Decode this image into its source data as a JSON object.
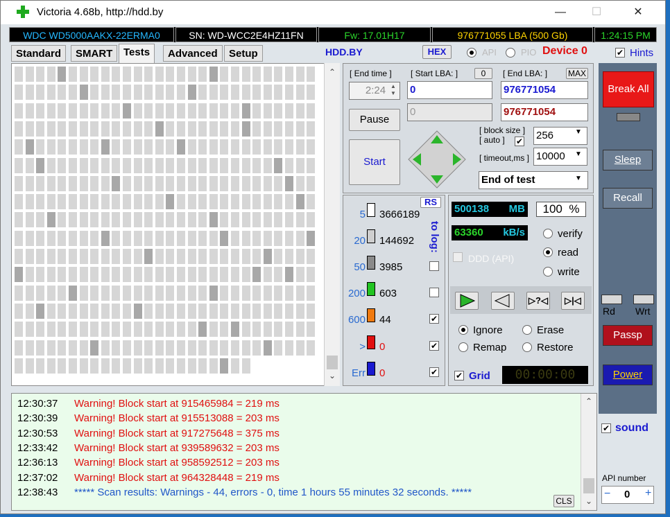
{
  "window": {
    "title": "Victoria 4.68b, http://hdd.by",
    "minimize": "—",
    "maximize": "☐",
    "close": "✕"
  },
  "info": {
    "model": "WDC WD5000AAKX-22ERMA0",
    "serial": "SN: WD-WCC2E4HZ11FN",
    "firmware": "Fw: 17.01H17",
    "lba": "976771055 LBA (500 Gb)",
    "clock": "1:24:15 PM"
  },
  "tabs": [
    "Standard",
    "SMART",
    "Tests",
    "Advanced",
    "Setup"
  ],
  "header": {
    "site": "HDD.BY",
    "hex": "HEX",
    "api": "API",
    "pio": "PIO",
    "device": "Device 0",
    "hints": "Hints"
  },
  "tests": {
    "end_time_label": "[ End time ]",
    "end_time_value": "2:24",
    "start_lba_label": "[ Start LBA: ]",
    "start_lba_zero": "0",
    "start_lba_value": "0",
    "start_lba_cur": "0",
    "end_lba_label": "[ End LBA: ]",
    "end_lba_max": "MAX",
    "end_lba_value": "976771054",
    "end_lba_cur": "976771054",
    "pause": "Pause",
    "start": "Start",
    "block_size_label1": "[ block size ]",
    "block_size_label2": "[ auto ]",
    "block_size_value": "256",
    "timeout_label": "[ timeout,ms ]",
    "timeout_value": "10000",
    "end_action": "End of test"
  },
  "counters": {
    "rs": "RS",
    "to_log": "to log:",
    "rows": [
      {
        "label": "5",
        "count": "3666189",
        "color": "#ffffff"
      },
      {
        "label": "20",
        "count": "144692",
        "color": "#cfcfcf"
      },
      {
        "label": "50",
        "count": "3985",
        "color": "#8a8a8a"
      },
      {
        "label": "200",
        "count": "603",
        "color": "#22c422"
      },
      {
        "label": "600",
        "count": "44",
        "color": "#f07a10"
      },
      {
        "label": ">",
        "count": "0",
        "color": "#e01010"
      },
      {
        "label": "Err",
        "count": "0",
        "color": "#1a1ad0"
      }
    ]
  },
  "stats": {
    "mb": "500138",
    "mb_unit": "MB",
    "percent": "100",
    "percent_unit": "%",
    "speed": "63360",
    "speed_unit": "kB/s",
    "ddd": "DDD (API)",
    "verify": "verify",
    "read": "read",
    "write": "write",
    "timer": "00:00:00"
  },
  "options": {
    "ignore": "Ignore",
    "erase": "Erase",
    "remap": "Remap",
    "restore": "Restore",
    "grid": "Grid"
  },
  "right": {
    "break_all": "Break All",
    "sleep": "Sleep",
    "recall": "Recall",
    "rd": "Rd",
    "wrt": "Wrt",
    "passp": "Passp",
    "power": "Power",
    "sound": "sound",
    "api_number_label": "API number",
    "api_number": "0",
    "minus": "−",
    "plus": "+"
  },
  "log": {
    "cls": "CLS",
    "lines": [
      {
        "time": "12:30:37",
        "text": "Warning! Block start at 915465984 = 219 ms"
      },
      {
        "time": "12:30:39",
        "text": "Warning! Block start at 915513088 = 203 ms"
      },
      {
        "time": "12:30:53",
        "text": "Warning! Block start at 917275648 = 375 ms"
      },
      {
        "time": "12:33:42",
        "text": "Warning! Block start at 939589632 = 203 ms"
      },
      {
        "time": "12:36:13",
        "text": "Warning! Block start at 958592512 = 203 ms"
      },
      {
        "time": "12:37:02",
        "text": "Warning! Block start at 964328448 = 219 ms"
      },
      {
        "time": "12:38:43",
        "text": "***** Scan results: Warnings - 44, errors - 0, time 1 hours 55 minutes 32 seconds.  *****"
      }
    ]
  }
}
